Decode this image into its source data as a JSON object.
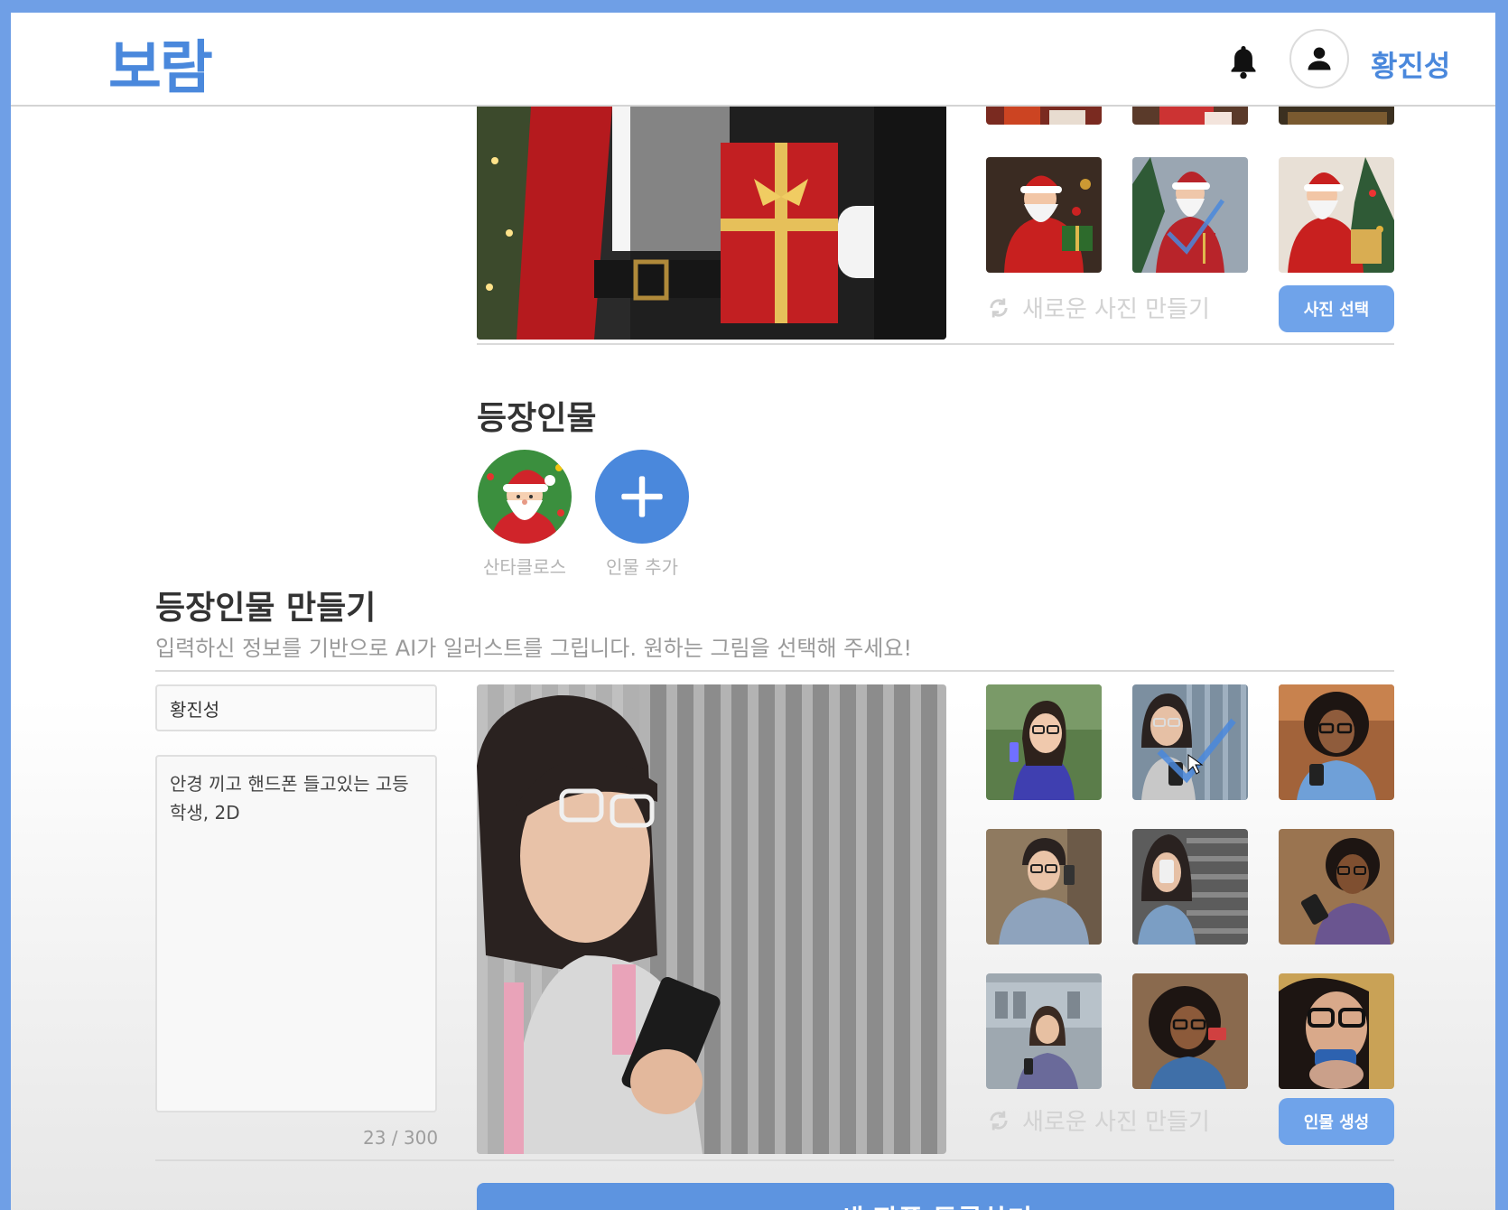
{
  "header": {
    "logo": "보람",
    "user_name": "황진성"
  },
  "background_section": {
    "regen_label": "새로운 사진 만들기",
    "select_button": "사진 선택"
  },
  "characters_section": {
    "title": "등장인물",
    "items": [
      {
        "label": "산타클로스"
      },
      {
        "label": "인물 추가"
      }
    ]
  },
  "create_character": {
    "title": "등장인물 만들기",
    "subtitle": "입력하신 정보를 기반으로 AI가 일러스트를 그립니다. 원하는 그림을 선택해 주세요!",
    "name_value": "황진성",
    "description_value": "안경 끼고 핸드폰 들고있는 고등학생, 2D",
    "counter": "23 / 300",
    "regen_label": "새로운 사진 만들기",
    "generate_button": "인물 생성"
  },
  "footer": {
    "submit_button": "새 작품 등록하기"
  },
  "colors": {
    "accent": "#4a88dc",
    "button": "#6fa3ea",
    "frame": "#6f9fe6"
  }
}
